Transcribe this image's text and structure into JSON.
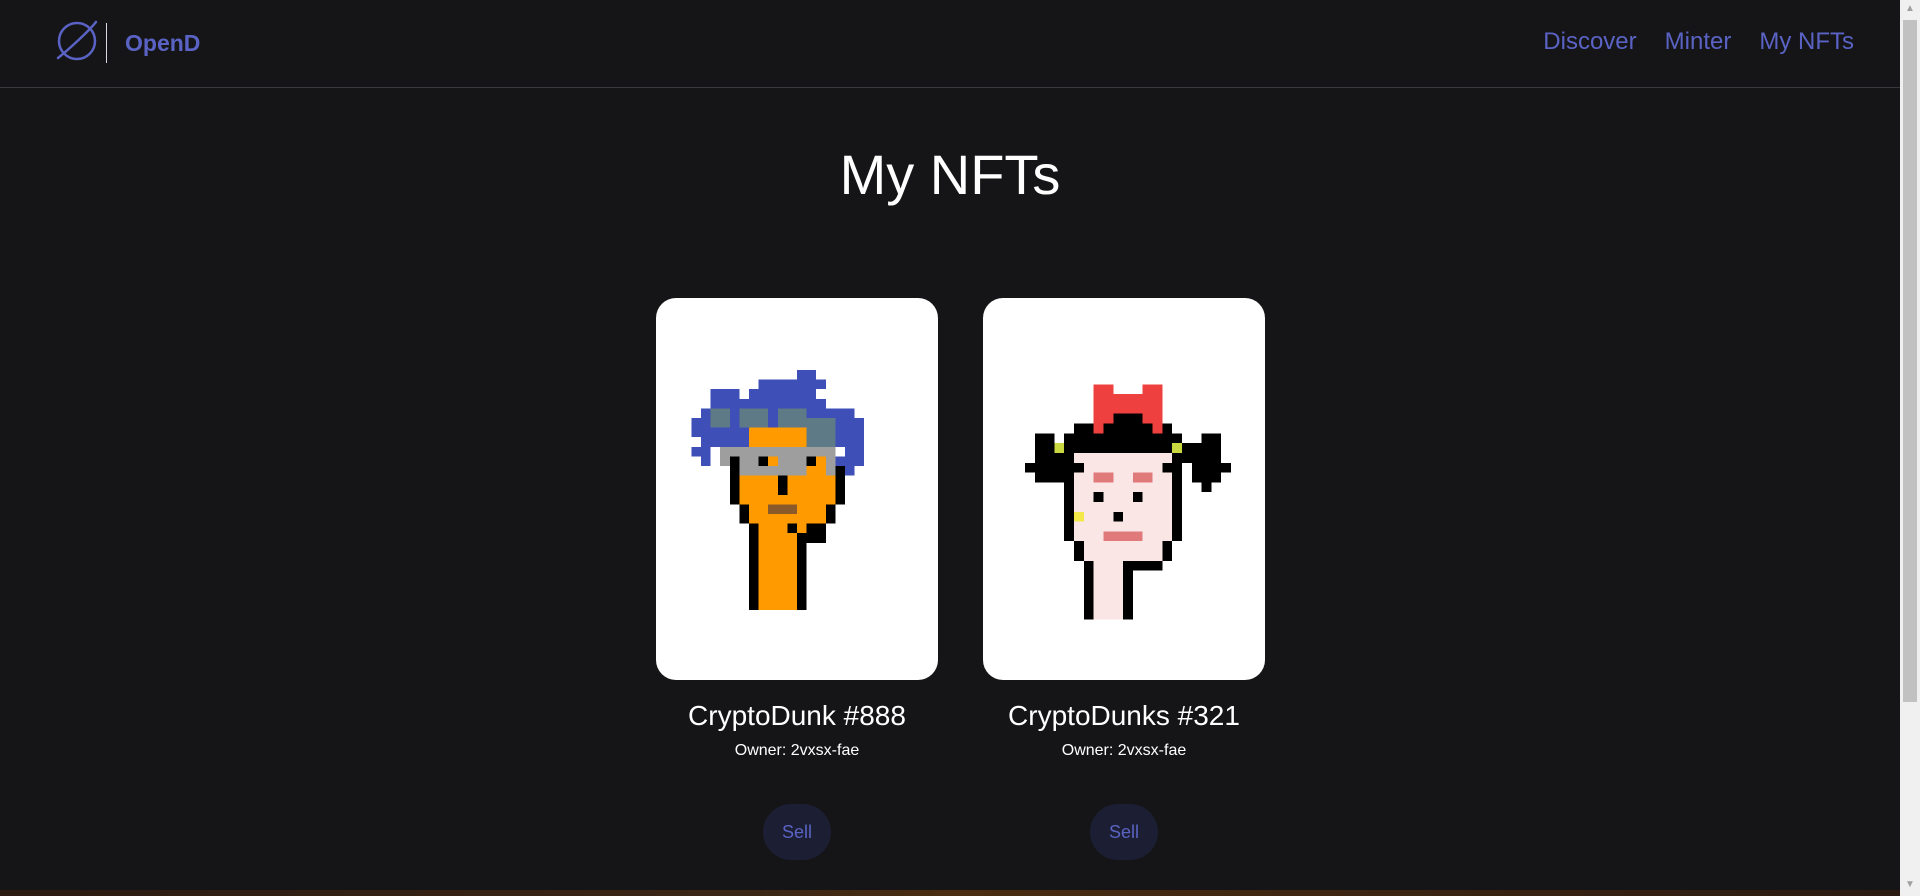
{
  "header": {
    "logo_icon": "planet-icon",
    "brand_name": "OpenD",
    "nav": [
      "Discover",
      "Minter",
      "My NFTs"
    ]
  },
  "main": {
    "page_title": "My NFTs",
    "cards": [
      {
        "name": "CryptoDunk #888",
        "owner_label": "Owner: 2vxsx-fae",
        "sell_label": "Sell",
        "image_icon": "punk-orange-face-image"
      },
      {
        "name": "CryptoDunks #321",
        "owner_label": "Owner: 2vxsx-fae",
        "sell_label": "Sell",
        "image_icon": "punk-devil-horns-image"
      }
    ]
  },
  "colors": {
    "background": "#151517",
    "accent": "#5a63c4",
    "text": "#ffffff",
    "button_bg": "#1c1f33"
  }
}
